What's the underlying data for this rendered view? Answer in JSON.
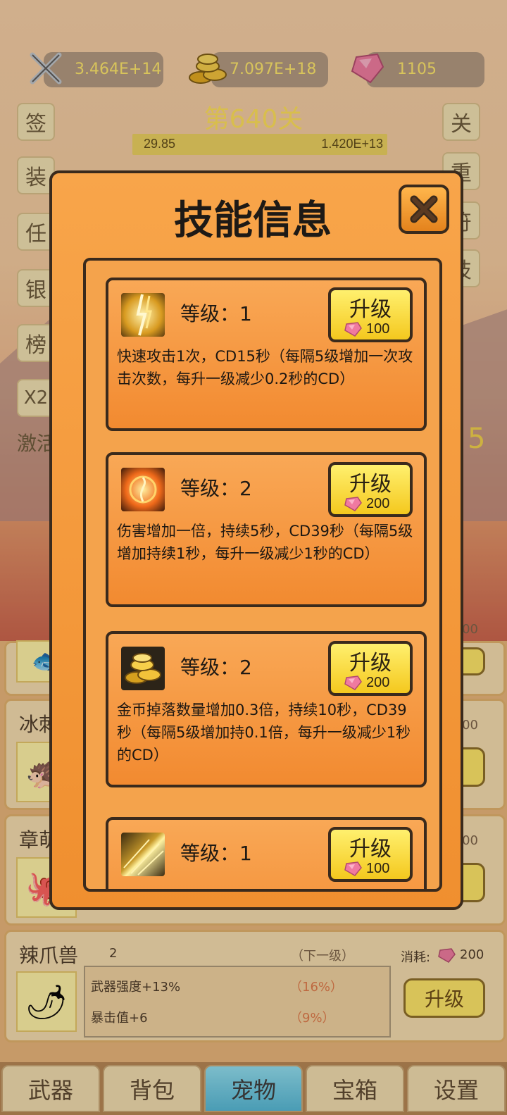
{
  "resources": {
    "attack": "3.464E+14",
    "gold": "7.097E+18",
    "gems": "1105"
  },
  "level": {
    "title": "第640关",
    "hp_left": "29.85",
    "hp_right": "1.420E+13"
  },
  "left_buttons": [
    "签",
    "装",
    "任",
    "银",
    "榜",
    "X2"
  ],
  "right_buttons": [
    "关",
    "重",
    "符",
    "技"
  ],
  "background_text": {
    "activate": "激活",
    "number": "5"
  },
  "dialog": {
    "title": "技能信息",
    "skills": [
      {
        "level_text": "等级：1",
        "upgrade_label": "升级",
        "cost": "100",
        "description": "快速攻击1次，CD15秒（每隔5级增加一次攻击次数，每升一级减少0.2秒的CD）"
      },
      {
        "level_text": "等级：2",
        "upgrade_label": "升级",
        "cost": "200",
        "description": "伤害增加一倍，持续5秒，CD39秒（每隔5级增加持续1秒，每升一级减少1秒的CD）"
      },
      {
        "level_text": "等级：2",
        "upgrade_label": "升级",
        "cost": "200",
        "description": "金币掉落数量增加0.3倍，持续10秒，CD39秒（每隔5级增加持0.1倍，每升一级减少1秒的CD）"
      },
      {
        "level_text": "等级：1",
        "upgrade_label": "升级",
        "cost": "100",
        "description": ""
      }
    ]
  },
  "pets": [
    {
      "name": "冰刺",
      "cost": "200",
      "upgrade_label": "级"
    },
    {
      "name": "章萌",
      "cost": "200",
      "upgrade_label": "级"
    },
    {
      "name": "辣爪兽",
      "level": "2",
      "next_label": "（下一级）",
      "cost_label": "消耗:",
      "cost": "200",
      "stat1": "武器强度+13%",
      "stat1_next": "（16%）",
      "stat2": "暴击值+6",
      "stat2_next": "（9%）",
      "upgrade_label": "升级"
    }
  ],
  "partial_cost": "200",
  "nav": [
    "武器",
    "背包",
    "宠物",
    "宝箱",
    "设置"
  ],
  "colors": {
    "dialog_orange": "#f08f2f",
    "button_yellow": "#f4c81e",
    "gem_pink": "#ec6c94",
    "active_tab": "#52b9d8"
  }
}
